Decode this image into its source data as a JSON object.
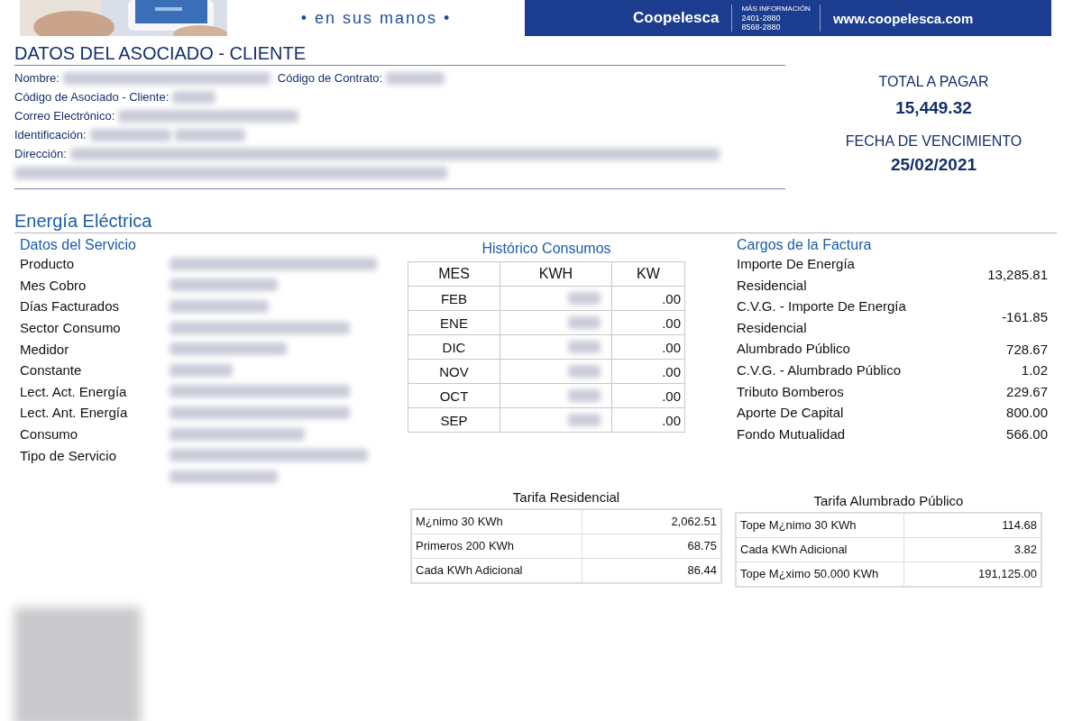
{
  "banner": {
    "slogan": "• en sus manos •",
    "brand": "Coopelesca",
    "info_label": "MÁS INFORMACIÓN",
    "phones": [
      "2401-2880",
      "8568-2880"
    ],
    "website": "www.coopelesca.com"
  },
  "client": {
    "title": "DATOS DEL ASOCIADO - CLIENTE",
    "fields": [
      {
        "label": "Nombre:",
        "inline_label": "Código de Contrato:"
      },
      {
        "label": "Código de Asociado - Cliente:"
      },
      {
        "label": "Correo Electrónico:"
      },
      {
        "label": "Identificación:"
      },
      {
        "label": "Dirección:"
      }
    ]
  },
  "summary": {
    "total_label": "TOTAL A PAGAR",
    "total": "15,449.32",
    "due_label": "FECHA DE VENCIMIENTO",
    "due_date": "25/02/2021"
  },
  "section_title": "Energía Eléctrica",
  "service": {
    "title": "Datos del Servicio",
    "labels": [
      "Producto",
      "Mes Cobro",
      "Días Facturados",
      "Sector Consumo",
      "Medidor",
      "Constante",
      "Lect. Act. Energía",
      "Lect. Ant. Energía",
      "Consumo",
      "Tipo de Servicio"
    ]
  },
  "history": {
    "title": "Histórico Consumos",
    "columns": [
      "MES",
      "KWH",
      "KW"
    ],
    "rows": [
      {
        "month": "FEB",
        "kw": ".00"
      },
      {
        "month": "ENE",
        "kw": ".00"
      },
      {
        "month": "DIC",
        "kw": ".00"
      },
      {
        "month": "NOV",
        "kw": ".00"
      },
      {
        "month": "OCT",
        "kw": ".00"
      },
      {
        "month": "SEP",
        "kw": ".00"
      }
    ]
  },
  "charges": {
    "title": "Cargos de la Factura",
    "rows": [
      {
        "label": "Importe De Energía Residencial",
        "amount": "13,285.81"
      },
      {
        "label": "C.V.G. - Importe De Energía Residencial",
        "amount": "-161.85"
      },
      {
        "label": "Alumbrado Público",
        "amount": "728.67"
      },
      {
        "label": "C.V.G. - Alumbrado Público",
        "amount": "1.02"
      },
      {
        "label": "Tributo Bomberos",
        "amount": "229.67"
      },
      {
        "label": "Aporte De Capital",
        "amount": "800.00"
      },
      {
        "label": "Fondo Mutualidad",
        "amount": "566.00"
      }
    ]
  },
  "tariffs": [
    {
      "title": "Tarifa Residencial",
      "rows": [
        {
          "label": "M¿nimo 30 KWh",
          "value": "2,062.51"
        },
        {
          "label": "Primeros 200 KWh",
          "value": "68.75"
        },
        {
          "label": "Cada KWh Adicional",
          "value": "86.44"
        }
      ]
    },
    {
      "title": "Tarifa Alumbrado Público",
      "rows": [
        {
          "label": "Tope M¿nimo 30 KWh",
          "value": "114.68"
        },
        {
          "label": "Cada KWh Adicional",
          "value": "3.82"
        },
        {
          "label": "Tope M¿ximo 50.000 KWh",
          "value": "191,125.00"
        }
      ]
    }
  ]
}
